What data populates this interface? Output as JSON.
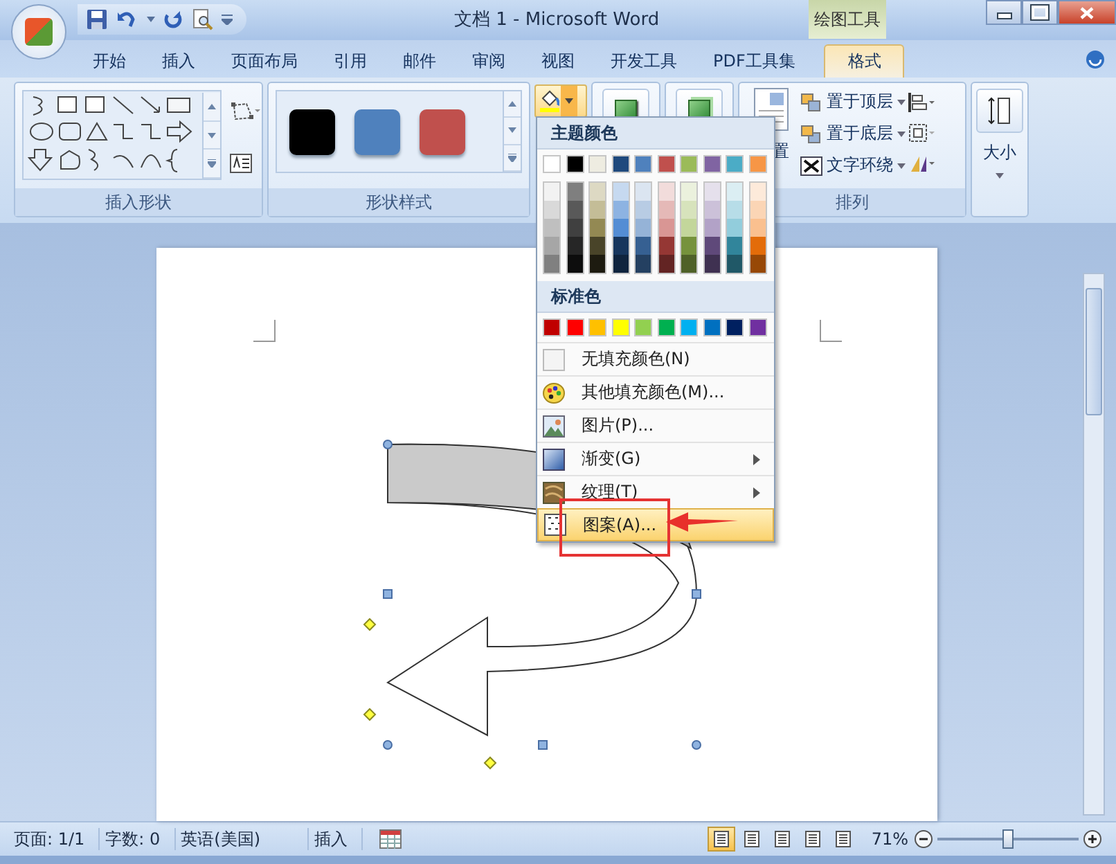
{
  "window": {
    "title": "文档 1 - Microsoft Word",
    "context_tab": "绘图工具"
  },
  "tabs": [
    {
      "label": "开始",
      "selected": false
    },
    {
      "label": "插入",
      "selected": false
    },
    {
      "label": "页面布局",
      "selected": false
    },
    {
      "label": "引用",
      "selected": false
    },
    {
      "label": "邮件",
      "selected": false
    },
    {
      "label": "审阅",
      "selected": false
    },
    {
      "label": "视图",
      "selected": false
    },
    {
      "label": "开发工具",
      "selected": false
    },
    {
      "label": "PDF工具集",
      "selected": false
    },
    {
      "label": "格式",
      "selected": true
    }
  ],
  "ribbon": {
    "insert_shapes": {
      "label": "插入形状"
    },
    "shape_styles": {
      "label": "形状样式",
      "swatches": [
        {
          "color": "#000000"
        },
        {
          "color": "#4f81bd"
        },
        {
          "color": "#c0504d"
        }
      ]
    },
    "arrange": {
      "position_label": "置",
      "buttons": [
        {
          "label": "置于顶层"
        },
        {
          "label": "置于底层"
        },
        {
          "label": "文字环绕"
        }
      ],
      "label": "排列"
    },
    "size": {
      "label": "大小"
    }
  },
  "fill_menu": {
    "theme_heading": "主题颜色",
    "theme_colors": [
      {
        "color": "#ffffff",
        "shades": [
          {
            "color": "#f2f2f2"
          },
          {
            "color": "#d9d9d9"
          },
          {
            "color": "#bfbfbf"
          },
          {
            "color": "#a6a6a6"
          },
          {
            "color": "#808080"
          }
        ]
      },
      {
        "color": "#000000",
        "shades": [
          {
            "color": "#7f7f7f"
          },
          {
            "color": "#595959"
          },
          {
            "color": "#404040"
          },
          {
            "color": "#262626"
          },
          {
            "color": "#0d0d0d"
          }
        ]
      },
      {
        "color": "#eeece1",
        "shades": [
          {
            "color": "#ddd9c3"
          },
          {
            "color": "#c4bd97"
          },
          {
            "color": "#938953"
          },
          {
            "color": "#494429"
          },
          {
            "color": "#1d1b10"
          }
        ]
      },
      {
        "color": "#1f497d",
        "shades": [
          {
            "color": "#c6d9f0"
          },
          {
            "color": "#8db3e2"
          },
          {
            "color": "#548dd4"
          },
          {
            "color": "#17365d"
          },
          {
            "color": "#0f243e"
          }
        ]
      },
      {
        "color": "#4f81bd",
        "shades": [
          {
            "color": "#dbe5f1"
          },
          {
            "color": "#b8cce4"
          },
          {
            "color": "#95b3d7"
          },
          {
            "color": "#366092"
          },
          {
            "color": "#244061"
          }
        ]
      },
      {
        "color": "#c0504d",
        "shades": [
          {
            "color": "#f2dcdb"
          },
          {
            "color": "#e5b9b7"
          },
          {
            "color": "#d99694"
          },
          {
            "color": "#953734"
          },
          {
            "color": "#632423"
          }
        ]
      },
      {
        "color": "#9bbb59",
        "shades": [
          {
            "color": "#ebf1dd"
          },
          {
            "color": "#d7e3bc"
          },
          {
            "color": "#c3d69b"
          },
          {
            "color": "#76923c"
          },
          {
            "color": "#4f6128"
          }
        ]
      },
      {
        "color": "#8064a2",
        "shades": [
          {
            "color": "#e5e0ec"
          },
          {
            "color": "#ccc1d9"
          },
          {
            "color": "#b2a2c7"
          },
          {
            "color": "#5f497a"
          },
          {
            "color": "#3f3151"
          }
        ]
      },
      {
        "color": "#4bacc6",
        "shades": [
          {
            "color": "#dbeef3"
          },
          {
            "color": "#b7dde8"
          },
          {
            "color": "#92cddc"
          },
          {
            "color": "#31859b"
          },
          {
            "color": "#205867"
          }
        ]
      },
      {
        "color": "#f79646",
        "shades": [
          {
            "color": "#fdeada"
          },
          {
            "color": "#fbd5b5"
          },
          {
            "color": "#fac08f"
          },
          {
            "color": "#e36c09"
          },
          {
            "color": "#974806"
          }
        ]
      }
    ],
    "standard_heading": "标准色",
    "standard_colors": [
      {
        "color": "#c00000"
      },
      {
        "color": "#ff0000"
      },
      {
        "color": "#ffc000"
      },
      {
        "color": "#ffff00"
      },
      {
        "color": "#92d050"
      },
      {
        "color": "#00b050"
      },
      {
        "color": "#00b0f0"
      },
      {
        "color": "#0070c0"
      },
      {
        "color": "#002060"
      },
      {
        "color": "#7030a0"
      }
    ],
    "items": [
      {
        "kind": "none",
        "label": "无填充颜色(N)",
        "submenu": false,
        "selected": false
      },
      {
        "kind": "palette",
        "label": "其他填充颜色(M)...",
        "submenu": false,
        "selected": false
      },
      {
        "kind": "picture",
        "label": "图片(P)...",
        "submenu": false,
        "selected": false
      },
      {
        "kind": "gradient",
        "label": "渐变(G)",
        "submenu": true,
        "selected": false
      },
      {
        "kind": "texture",
        "label": "纹理(T)",
        "submenu": true,
        "selected": false
      },
      {
        "kind": "pattern",
        "label": "图案(A)...",
        "submenu": false,
        "selected": true
      }
    ]
  },
  "status_bar": {
    "page": "页面: 1/1",
    "words": "字数: 0",
    "language": "英语(美国)",
    "mode": "插入",
    "views": [
      {
        "selected": true
      },
      {
        "selected": false
      },
      {
        "selected": false
      },
      {
        "selected": false
      },
      {
        "selected": false
      }
    ],
    "zoom": "71%",
    "zoom_level": {
      "level": 0.5
    }
  }
}
